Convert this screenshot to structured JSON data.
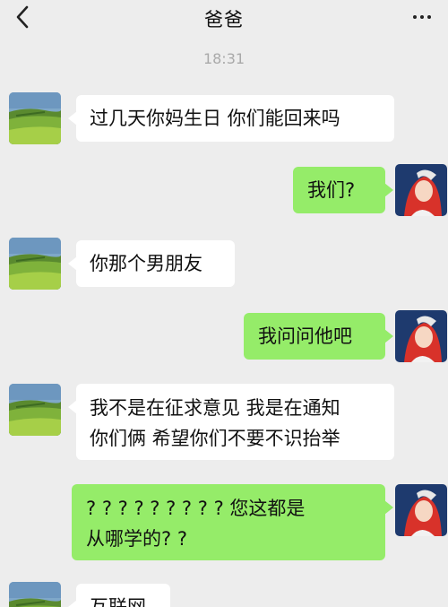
{
  "header": {
    "title": "爸爸",
    "back_icon": "chevron-left-icon",
    "more_icon": "more-dots-icon"
  },
  "timestamp": "18:31",
  "colors": {
    "background": "#ededed",
    "bubble_received": "#ffffff",
    "bubble_sent": "#95ec69"
  },
  "messages": [
    {
      "sender": "dad",
      "lines": [
        "过几天你妈生日 你们能回来吗"
      ]
    },
    {
      "sender": "me",
      "lines": [
        "我们?"
      ]
    },
    {
      "sender": "dad",
      "lines": [
        "你那个男朋友"
      ]
    },
    {
      "sender": "me",
      "lines": [
        "我问问他吧"
      ]
    },
    {
      "sender": "dad",
      "lines": [
        "我不是在征求意见 我是在通知",
        "你们俩 希望你们不要不识抬举"
      ]
    },
    {
      "sender": "me",
      "lines": [
        "? ? ? ? ? ? ? ? ?  您这都是",
        "从哪学的? ?"
      ]
    },
    {
      "sender": "dad",
      "lines": [
        "互联网"
      ]
    }
  ]
}
